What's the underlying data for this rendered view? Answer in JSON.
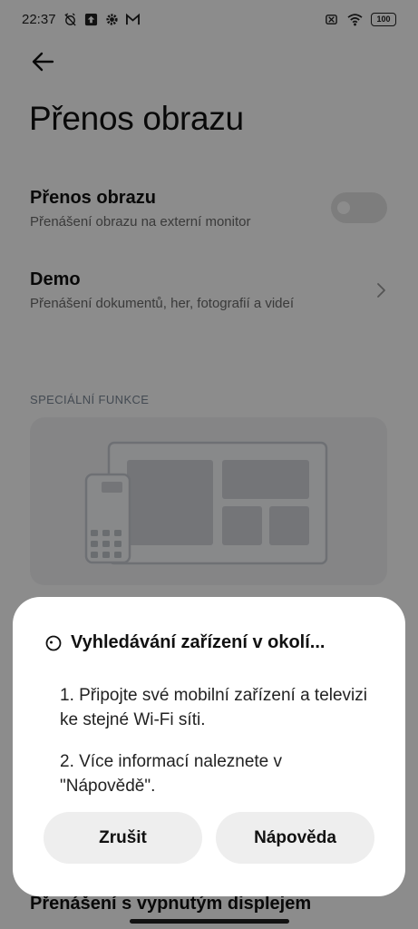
{
  "status_bar": {
    "time": "22:37",
    "left_icons": [
      "alarm-off-icon",
      "upload-icon",
      "settings-gear-icon",
      "gmail-icon"
    ],
    "right_icons": [
      "no-sim-icon",
      "wifi-icon"
    ],
    "battery": "100"
  },
  "header": {
    "back_icon": "back-arrow-icon",
    "title": "Přenos obrazu"
  },
  "settings": {
    "cast": {
      "title": "Přenos obrazu",
      "subtitle": "Přenášení obrazu na externí monitor",
      "toggle_on": false
    },
    "demo": {
      "title": "Demo",
      "subtitle": "Přenášení dokumentů, her, fotografií a videí"
    },
    "section_header": "SPECIÁLNÍ FUNKCE",
    "hidden_row_title": "Přenášení s vypnutým displejem"
  },
  "dialog": {
    "title": "Vyhledávání zařízení v okolí...",
    "line1": "1. Připojte své mobilní zařízení a televizi ke stejné Wi-Fi síti.",
    "line2": "2. Více informací naleznete v \"Nápovědě\".",
    "cancel_label": "Zrušit",
    "help_label": "Nápověda"
  },
  "colors": {
    "dim_overlay": "#000000",
    "card_background": "#f2f3f5",
    "button_background": "#eeeeee",
    "section_header": "#7b8796"
  }
}
